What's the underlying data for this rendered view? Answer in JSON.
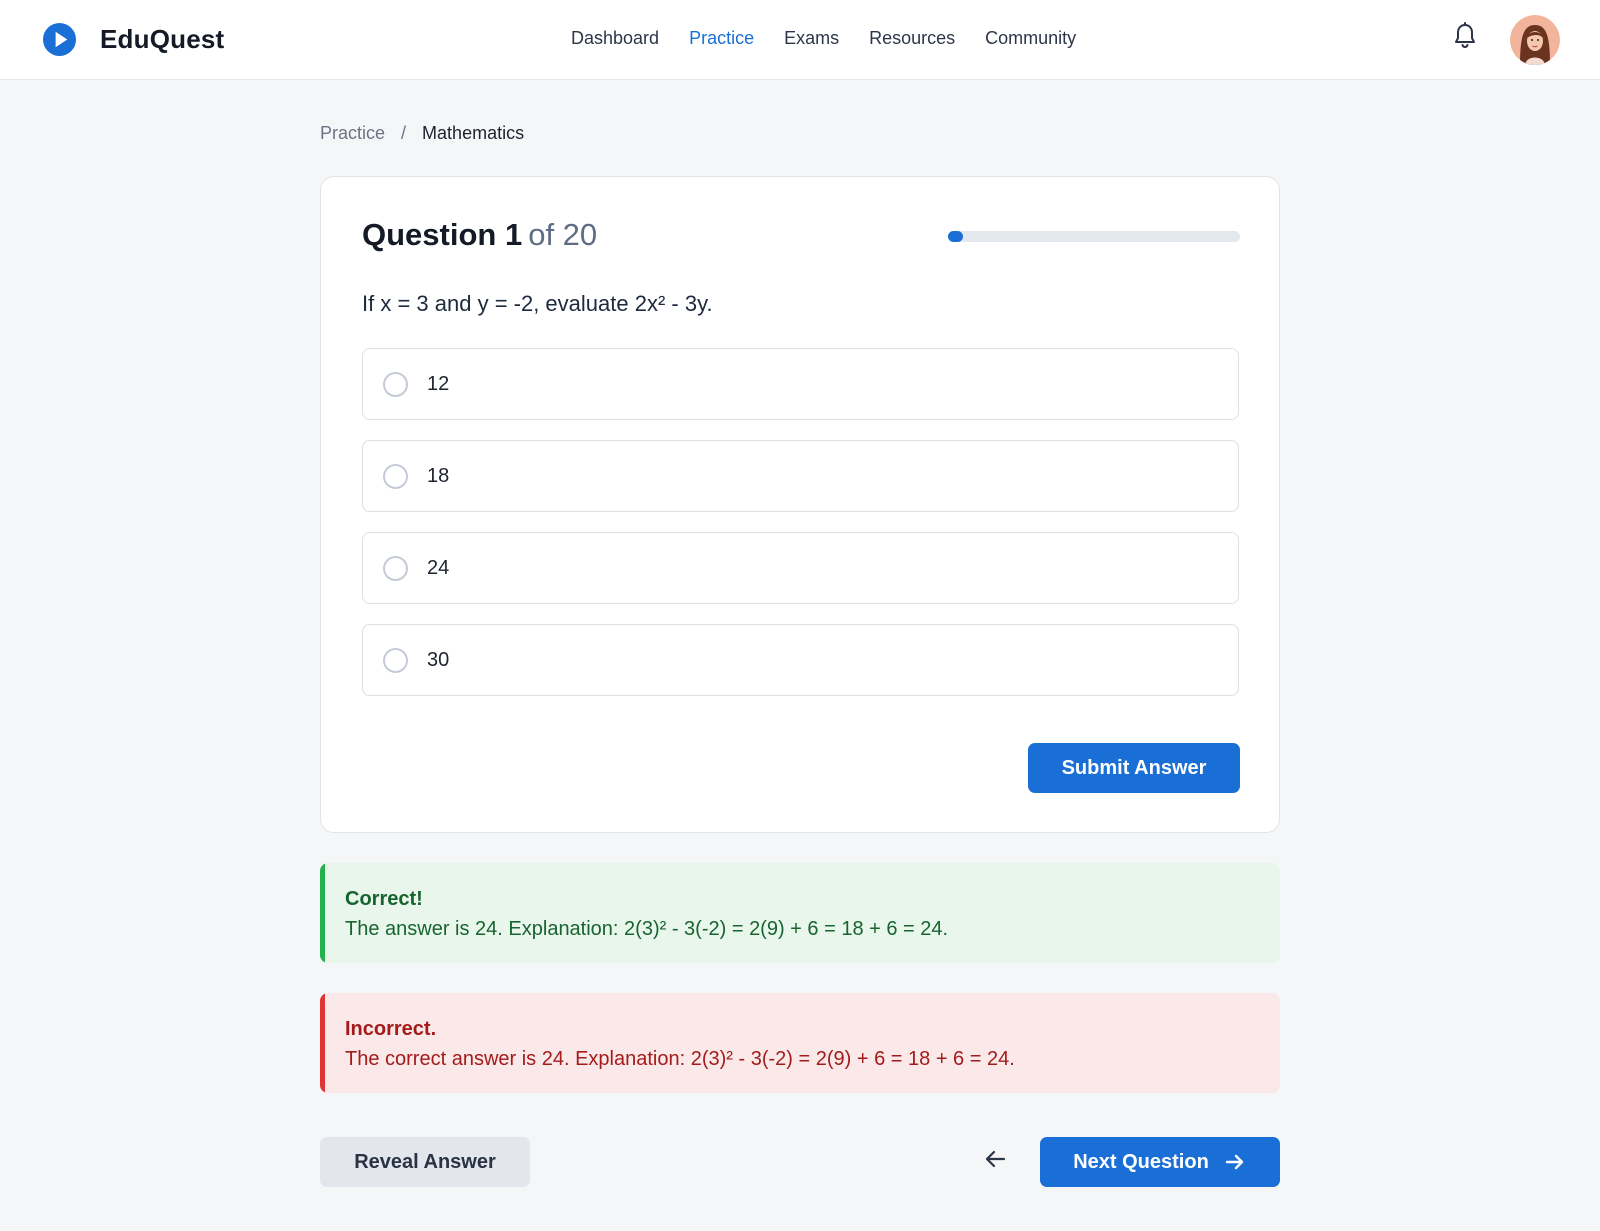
{
  "app": {
    "name": "EduQuest"
  },
  "nav": {
    "items": [
      {
        "label": "Dashboard",
        "active": false
      },
      {
        "label": "Practice",
        "active": true
      },
      {
        "label": "Exams",
        "active": false
      },
      {
        "label": "Resources",
        "active": false
      },
      {
        "label": "Community",
        "active": false
      }
    ]
  },
  "icons": {
    "logo": "play-circle-icon",
    "notifications": "bell-icon",
    "back": "arrow-left-icon",
    "next": "arrow-right-icon"
  },
  "breadcrumb": {
    "parent": "Practice",
    "separator": "/",
    "current": "Mathematics"
  },
  "question": {
    "label": "Question 1",
    "of": "of 20",
    "current": 1,
    "total": 20,
    "progress_fraction": 0.05,
    "text": "If x = 3 and y = -2, evaluate 2x² - 3y."
  },
  "options": [
    {
      "label": "12",
      "selected": false
    },
    {
      "label": "18",
      "selected": false
    },
    {
      "label": "24",
      "selected": false
    },
    {
      "label": "30",
      "selected": false
    }
  ],
  "actions": {
    "submit": "Submit Answer",
    "reveal": "Reveal Answer",
    "next": "Next Question"
  },
  "feedback": {
    "correct": {
      "title": "Correct!",
      "body": "The answer is 24. Explanation: 2(3)² - 3(-2) = 2(9) + 6 = 18 + 6 = 24."
    },
    "incorrect": {
      "title": "Incorrect.",
      "body": "The correct answer is 24. Explanation: 2(3)² - 3(-2) = 2(9) + 6 = 18 + 6 = 24."
    }
  },
  "colors": {
    "primary": "#1a6fd6",
    "success": "#22b14c",
    "error": "#e03535",
    "background": "#f5f6f8"
  }
}
